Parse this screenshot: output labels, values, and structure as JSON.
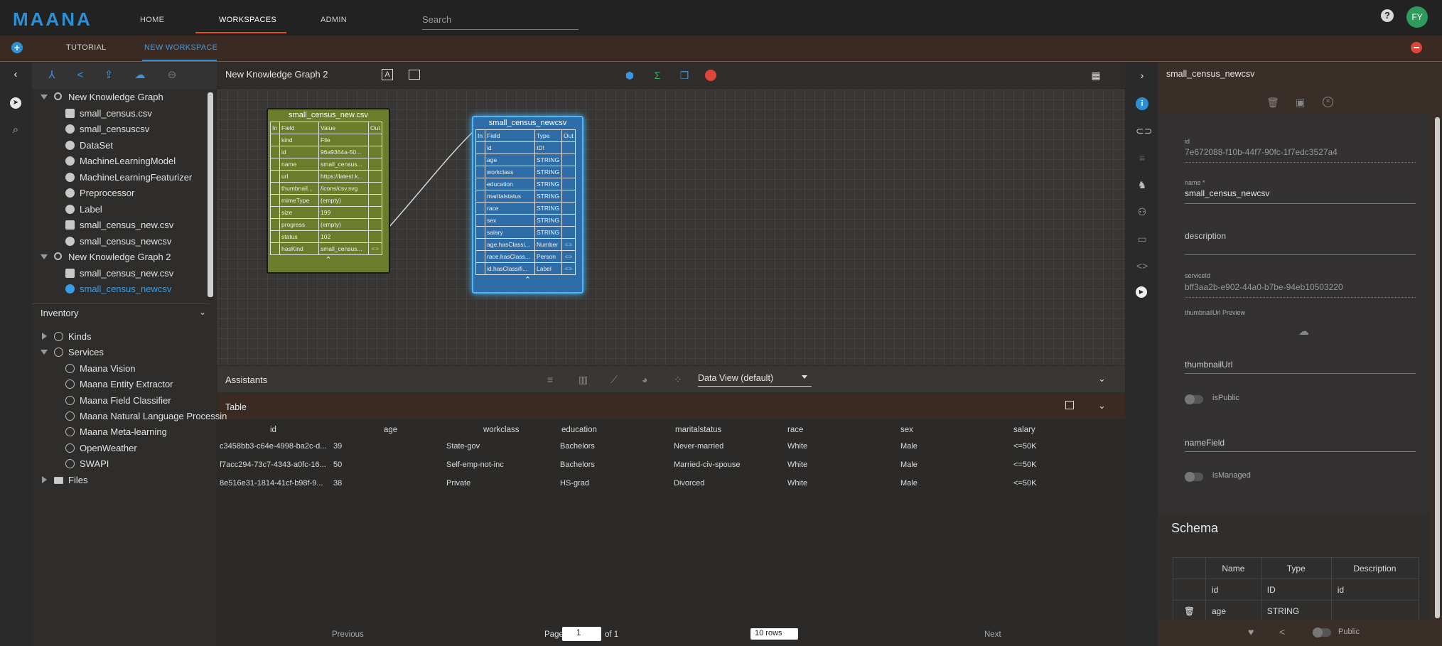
{
  "app": {
    "logo": "MAANA",
    "nav": [
      "HOME",
      "WORKSPACES",
      "ADMIN"
    ],
    "search_placeholder": "Search",
    "help": "?",
    "avatar": "FY"
  },
  "workspace_tabs": [
    "TUTORIAL",
    "NEW WORKSPACE"
  ],
  "explorer": {
    "toolbar_icons": [
      "graph-icon",
      "share-icon",
      "upload-icon",
      "cloud-upload-icon",
      "remove-icon"
    ],
    "tree": [
      {
        "label": "New Knowledge Graph",
        "level": 0,
        "icon": "graph-icon"
      },
      {
        "label": "small_census.csv",
        "level": 1,
        "icon": "save-icon"
      },
      {
        "label": "small_censuscsv",
        "level": 1,
        "icon": "kind-icon"
      },
      {
        "label": "DataSet",
        "level": 1,
        "icon": "kind-icon"
      },
      {
        "label": "MachineLearningModel",
        "level": 1,
        "icon": "kind-icon"
      },
      {
        "label": "MachineLearningFeaturizer",
        "level": 1,
        "icon": "kind-icon"
      },
      {
        "label": "Preprocessor",
        "level": 1,
        "icon": "kind-icon"
      },
      {
        "label": "Label",
        "level": 1,
        "icon": "kind-icon"
      },
      {
        "label": "small_census_new.csv",
        "level": 1,
        "icon": "save-icon"
      },
      {
        "label": "small_census_newcsv",
        "level": 1,
        "icon": "kind-icon"
      },
      {
        "label": "New Knowledge Graph 2",
        "level": 0,
        "icon": "graph-icon"
      },
      {
        "label": "small_census_new.csv",
        "level": 1,
        "icon": "save-icon"
      },
      {
        "label": "small_census_newcsv",
        "level": 1,
        "icon": "kind-icon",
        "selected": true
      }
    ],
    "inventory_label": "Inventory",
    "inventory": [
      {
        "label": "Kinds",
        "level": 0,
        "expanded": false
      },
      {
        "label": "Services",
        "level": 0,
        "expanded": true
      },
      {
        "label": "Maana Vision",
        "level": 1
      },
      {
        "label": "Maana Entity Extractor",
        "level": 1
      },
      {
        "label": "Maana Field Classifier",
        "level": 1
      },
      {
        "label": "Maana Natural Language Processin",
        "level": 1
      },
      {
        "label": "Maana Meta-learning",
        "level": 1
      },
      {
        "label": "OpenWeather",
        "level": 1
      },
      {
        "label": "SWAPI",
        "level": 1
      },
      {
        "label": "Files",
        "level": 0,
        "expanded": false
      }
    ]
  },
  "canvas": {
    "title": "New Knowledge Graph 2",
    "node_file": {
      "title": "small_census_new.csv",
      "headers": [
        "In",
        "Field",
        "Value",
        "Out"
      ],
      "rows": [
        [
          "kind",
          "File"
        ],
        [
          "id",
          "96a9364a-50..."
        ],
        [
          "name",
          "small_census..."
        ],
        [
          "url",
          "https://latest.k..."
        ],
        [
          "thumbnail...",
          "/icons/csv.svg"
        ],
        [
          "mimeType",
          "(empty)"
        ],
        [
          "size",
          "199"
        ],
        [
          "progress",
          "(empty)"
        ],
        [
          "status",
          "102"
        ],
        [
          "hasKind",
          "small_census..."
        ]
      ]
    },
    "node_kind": {
      "title": "small_census_newcsv",
      "headers": [
        "In",
        "Field",
        "Type",
        "Out"
      ],
      "rows": [
        [
          "id",
          "ID!"
        ],
        [
          "age",
          "STRING"
        ],
        [
          "workclass",
          "STRING"
        ],
        [
          "education",
          "STRING"
        ],
        [
          "maritalstatus",
          "STRING"
        ],
        [
          "race",
          "STRING"
        ],
        [
          "sex",
          "STRING"
        ],
        [
          "salary",
          "STRING"
        ],
        [
          "age.hasClassi...",
          "Number"
        ],
        [
          "race.hasClass...",
          "Person"
        ],
        [
          "id.hasClassifi...",
          "Label"
        ]
      ]
    }
  },
  "assistants": {
    "label": "Assistants",
    "view_select": "Data View (default)"
  },
  "table": {
    "label": "Table",
    "columns": [
      "id",
      "age",
      "workclass",
      "education",
      "maritalstatus",
      "race",
      "sex",
      "salary"
    ],
    "rows": [
      [
        "c3458bb3-c64e-4998-ba2c-d...",
        "39",
        "State-gov",
        "Bachelors",
        "Never-married",
        "White",
        "Male",
        "<=50K"
      ],
      [
        "f7acc294-73c7-4343-a0fc-16...",
        "50",
        "Self-emp-not-inc",
        "Bachelors",
        "Married-civ-spouse",
        "White",
        "Male",
        "<=50K"
      ],
      [
        "8e516e31-1814-41cf-b98f-9...",
        "38",
        "Private",
        "HS-grad",
        "Divorced",
        "White",
        "Male",
        "<=50K"
      ]
    ],
    "pager": {
      "previous": "Previous",
      "page_label": "Page",
      "page_value": "1",
      "of_label": "of 1",
      "rows_select": "10 rows",
      "next": "Next"
    }
  },
  "properties": {
    "title": "small_census_newcsv",
    "id_label": "id",
    "id_value": "7e672088-f10b-44f7-90fc-1f7edc3527a4",
    "name_label": "name *",
    "name_value": "small_census_newcsv",
    "description_label": "description",
    "serviceid_label": "serviceId",
    "serviceid_value": "bff3aa2b-e902-44a0-b7be-94eb10503220",
    "thumb_preview_label": "thumbnailUrl Preview",
    "thumbnailurl_label": "thumbnailUrl",
    "ispublic_label": "isPublic",
    "namefield_label": "nameField",
    "ismanaged_label": "isManaged",
    "schema_label": "Schema",
    "schema_headers": [
      "Name",
      "Type",
      "Description"
    ],
    "schema_rows": [
      [
        "id",
        "ID",
        "id"
      ],
      [
        "age",
        "STRING",
        ""
      ]
    ],
    "footer_public": "Public"
  },
  "colors": {
    "accent": "#2d8fd6",
    "danger": "#e0453a",
    "node_green": "#6b7c2a",
    "node_blue": "#2e6da7"
  }
}
